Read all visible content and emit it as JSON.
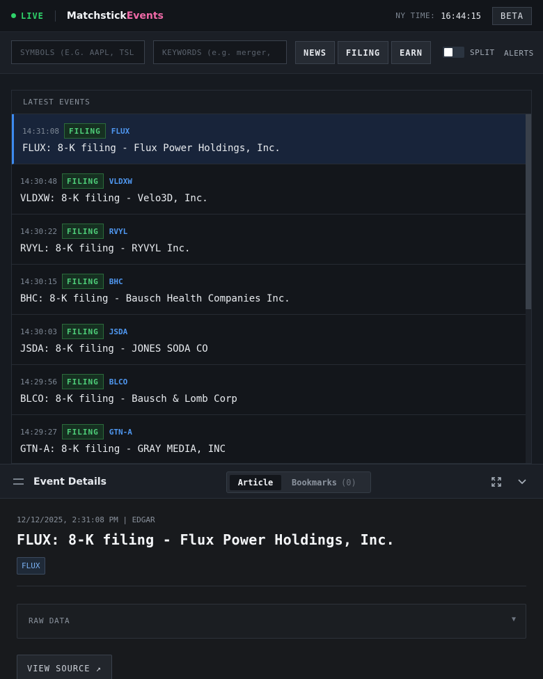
{
  "topbar": {
    "live_label": "LIVE",
    "brand_main": "Matchstick",
    "brand_accent": "Events",
    "ny_time_label": "NY TIME:",
    "ny_time_value": "16:44:15",
    "beta_label": "BETA"
  },
  "filters": {
    "symbols_placeholder": "SYMBOLS (E.G. AAPL, TSL",
    "keywords_placeholder": "KEYWORDS (e.g. merger,",
    "news_label": "NEWS",
    "filing_label": "FILING",
    "earn_label": "EARN",
    "split_label": "SPLIT",
    "alerts_label": "ALERTS"
  },
  "events": {
    "header": "LATEST EVENTS",
    "items": [
      {
        "time": "14:31:08",
        "type": "FILING",
        "symbol": "FLUX",
        "title": "FLUX: 8-K filing - Flux Power Holdings, Inc."
      },
      {
        "time": "14:30:48",
        "type": "FILING",
        "symbol": "VLDXW",
        "title": "VLDXW: 8-K filing - Velo3D, Inc."
      },
      {
        "time": "14:30:22",
        "type": "FILING",
        "symbol": "RVYL",
        "title": "RVYL: 8-K filing - RYVYL Inc."
      },
      {
        "time": "14:30:15",
        "type": "FILING",
        "symbol": "BHC",
        "title": "BHC: 8-K filing - Bausch Health Companies Inc."
      },
      {
        "time": "14:30:03",
        "type": "FILING",
        "symbol": "JSDA",
        "title": "JSDA: 8-K filing - JONES SODA CO"
      },
      {
        "time": "14:29:56",
        "type": "FILING",
        "symbol": "BLCO",
        "title": "BLCO: 8-K filing - Bausch & Lomb Corp"
      },
      {
        "time": "14:29:27",
        "type": "FILING",
        "symbol": "GTN-A",
        "title": "GTN-A: 8-K filing - GRAY MEDIA, INC"
      }
    ]
  },
  "details": {
    "header_title": "Event Details",
    "tab_article": "Article",
    "tab_bookmarks": "Bookmarks",
    "bookmarks_count": "(0)",
    "meta": "12/12/2025, 2:31:08 PM | EDGAR",
    "title": "FLUX: 8-K filing - Flux Power Holdings, Inc.",
    "tag": "FLUX",
    "raw_data_label": "RAW DATA",
    "raw_caret": "▼",
    "view_source_label": "VIEW SOURCE ↗"
  },
  "icons": {
    "live": "live-dot-icon",
    "drag": "drag-handle-icon",
    "expand": "expand-icon",
    "collapse": "chevron-down-icon"
  },
  "colors": {
    "live_green": "#2fd26a",
    "brand_accent": "#f06aa8",
    "filing_green": "#4fd07a",
    "symbol_blue": "#4f97f0",
    "active_border": "#3d8bf0"
  }
}
